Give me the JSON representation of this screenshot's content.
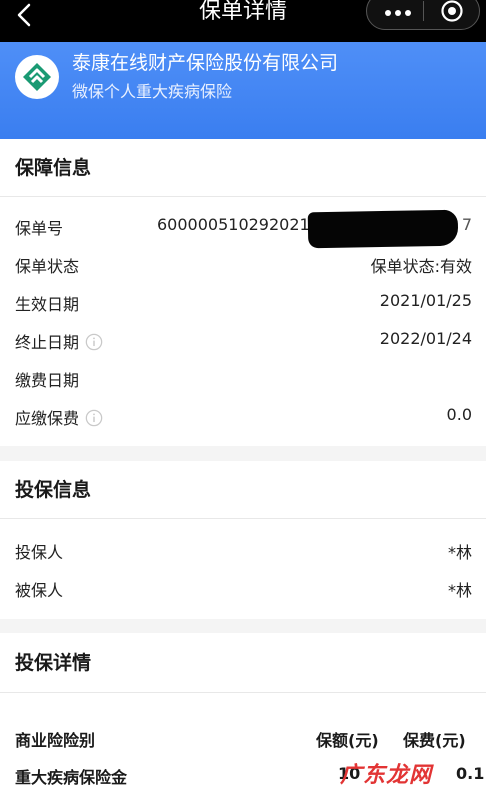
{
  "nav": {
    "title": "保单详情"
  },
  "header": {
    "company": "泰康在线财产保险股份有限公司",
    "product": "微保个人重大疾病保险"
  },
  "coverage": {
    "title": "保障信息",
    "rows": [
      {
        "label": "保单号",
        "value": "6000005102920210",
        "tail": "7"
      },
      {
        "label": "保单状态",
        "value": "保单状态:有效"
      },
      {
        "label": "生效日期",
        "value": "2021/01/25"
      },
      {
        "label": "终止日期",
        "value": "2022/01/24"
      },
      {
        "label": "缴费日期",
        "value": ""
      },
      {
        "label": "应缴保费",
        "value": "0.0"
      }
    ]
  },
  "insure": {
    "title": "投保信息",
    "rows": [
      {
        "label": "投保人",
        "value": "*林"
      },
      {
        "label": "被保人",
        "value": "*林"
      }
    ]
  },
  "detail": {
    "title": "投保详情",
    "header": {
      "label": "商业险险别",
      "col1": "保额(元)",
      "col2": "保费(元)"
    },
    "row": {
      "label": "重大疾病保险金",
      "col1": "10",
      "col2": "0.1"
    }
  },
  "watermark": "广东龙网",
  "colors": {
    "header_blue": "#3a7ef0",
    "logo_green": "#1a9a73",
    "nav_black": "#000000"
  }
}
